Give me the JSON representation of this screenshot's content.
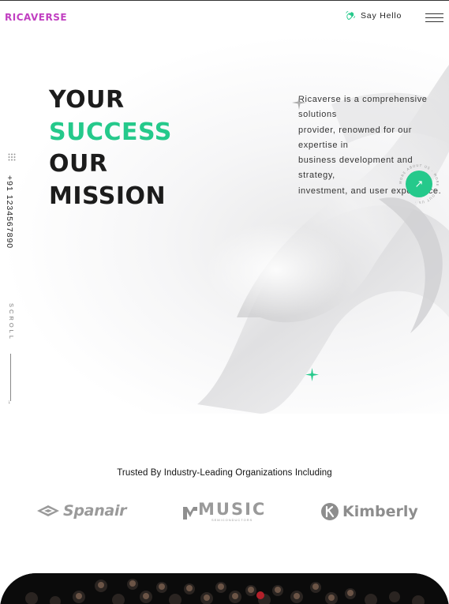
{
  "brand": {
    "logo_text": "RICAVERSE",
    "color": "#c13fc1"
  },
  "header": {
    "say_hello": "Say Hello",
    "wave_icon": "waving-hand-icon",
    "menu_icon": "hamburger-icon"
  },
  "hero": {
    "headline": {
      "line1": "YOUR",
      "line2": "SUCCESS",
      "line3": "OUR",
      "line4": "MISSION"
    },
    "accent_color": "#25c98b",
    "description": [
      "Ricaverse is a comprehensive",
      "solutions",
      "provider, renowned for our",
      "expertise in",
      "business development and",
      "strategy,",
      "investment, and user experience."
    ],
    "cta_icon": "arrow-up-right-icon",
    "cta_ring_text": "MORE ABOUT US · MORE ABOUT US ·"
  },
  "sidebar": {
    "phone": "+91 1234567890",
    "scroll_label": "SCROLL",
    "dots_icon": "grid-dots-icon"
  },
  "trusted": {
    "heading": "Trusted By Industry-Leading Organizations Including",
    "logos": [
      {
        "name": "Spanair",
        "icon": "spanair-logo-icon"
      },
      {
        "name": "MUSIC",
        "sub": "SEMICONDUCTORS",
        "icon": "music-logo-icon"
      },
      {
        "name": "Kimberly",
        "icon": "kimberly-logo-icon"
      }
    ]
  }
}
